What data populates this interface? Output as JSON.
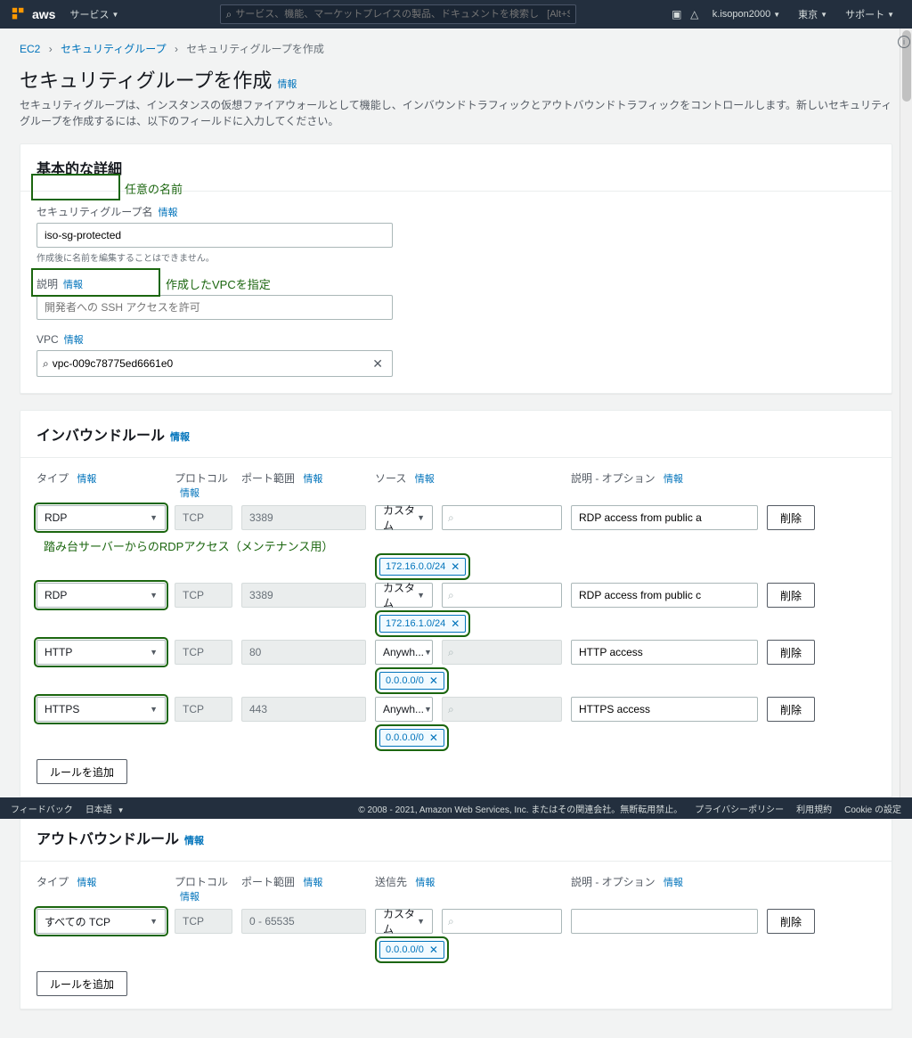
{
  "nav": {
    "services": "サービス",
    "search_placeholder": "サービス、機能、マーケットプレイスの製品、ドキュメントを検索し   [Alt+S]",
    "account": "k.isopon2000",
    "region": "東京",
    "support": "サポート"
  },
  "breadcrumb": {
    "ec2": "EC2",
    "sg": "セキュリティグループ",
    "current": "セキュリティグループを作成"
  },
  "page": {
    "title": "セキュリティグループを作成",
    "info": "情報",
    "desc": "セキュリティグループは、インスタンスの仮想ファイアウォールとして機能し、インバウンドトラフィックとアウトバウンドトラフィックをコントロールします。新しいセキュリティグループを作成するには、以下のフィールドに入力してください。"
  },
  "basic": {
    "heading": "基本的な詳細",
    "name_label": "セキュリティグループ名",
    "name_value": "iso-sg-protected",
    "name_hint": "作成後に名前を編集することはできません。",
    "desc_label": "説明",
    "desc_placeholder": "開発者への SSH アクセスを許可",
    "vpc_label": "VPC",
    "vpc_value": "vpc-009c78775ed6661e0"
  },
  "labels": {
    "type": "タイプ",
    "protocol": "プロトコル",
    "port": "ポート範囲",
    "source": "ソース",
    "dest": "送信先",
    "desc_opt": "説明 - オプション",
    "delete": "削除",
    "add_rule": "ルールを追加",
    "custom": "カスタム",
    "anywhere": "Anywh..."
  },
  "inbound": {
    "heading": "インバウンドルール",
    "rules": [
      {
        "type": "RDP",
        "proto": "TCP",
        "port": "3389",
        "src": "custom",
        "chip": "172.16.0.0/24",
        "desc": "RDP access from public a"
      },
      {
        "type": "RDP",
        "proto": "TCP",
        "port": "3389",
        "src": "custom",
        "chip": "172.16.1.0/24",
        "desc": "RDP access from public c"
      },
      {
        "type": "HTTP",
        "proto": "TCP",
        "port": "80",
        "src": "anywhere",
        "chip": "0.0.0.0/0",
        "desc": "HTTP access",
        "srch_ro": true
      },
      {
        "type": "HTTPS",
        "proto": "TCP",
        "port": "443",
        "src": "anywhere",
        "chip": "0.0.0.0/0",
        "desc": "HTTPS access",
        "srch_ro": true
      }
    ]
  },
  "outbound": {
    "heading": "アウトバウンドルール",
    "rules": [
      {
        "type": "すべての TCP",
        "proto": "TCP",
        "port": "0 - 65535",
        "src": "custom",
        "chip": "0.0.0.0/0",
        "desc": ""
      }
    ]
  },
  "annotations": {
    "name_note": "任意の名前",
    "vpc_note": "作成したVPCを指定",
    "rdp_note": "踏み台サーバーからのRDPアクセス（メンテナンス用）"
  },
  "footer": {
    "feedback": "フィードバック",
    "lang": "日本語",
    "copyright": "© 2008 - 2021, Amazon Web Services, Inc. またはその関連会社。無断転用禁止。",
    "privacy": "プライバシーポリシー",
    "terms": "利用規約",
    "cookie": "Cookie の設定"
  }
}
